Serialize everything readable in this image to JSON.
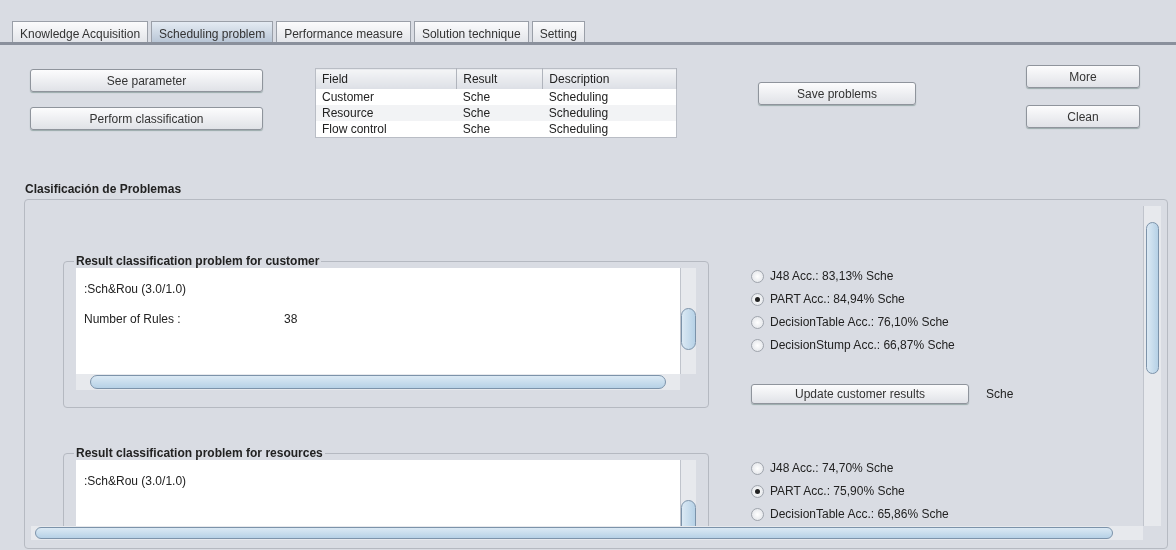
{
  "tabs": [
    {
      "label": "Knowledge Acquisition",
      "selected": false
    },
    {
      "label": "Scheduling problem",
      "selected": true
    },
    {
      "label": "Performance measure",
      "selected": false
    },
    {
      "label": "Solution technique",
      "selected": false
    },
    {
      "label": "Setting",
      "selected": false
    }
  ],
  "left_buttons": [
    "See parameter",
    "Perform classification"
  ],
  "table": {
    "columns": [
      "Field",
      "Result",
      "Description"
    ],
    "rows": [
      [
        "Customer",
        "Sche",
        "Scheduling"
      ],
      [
        "Resource",
        "Sche",
        "Scheduling"
      ],
      [
        "Flow control",
        "Sche",
        "Scheduling"
      ]
    ]
  },
  "save_button": "Save problems",
  "right_buttons": [
    "More",
    "Clean"
  ],
  "section_title": "Clasificación de Problemas",
  "panels": [
    {
      "title": "Result classification problem for customer",
      "lines": [
        {
          "label": ":Sch&Rou (3.0/1.0)"
        },
        {
          "label": "Number of Rules  :",
          "value": "38"
        }
      ],
      "options": [
        {
          "label": "J48 Acc.: 83,13% Sche",
          "selected": false
        },
        {
          "label": "PART Acc.: 84,94% Sche",
          "selected": true
        },
        {
          "label": "DecisionTable Acc.: 76,10% Sche",
          "selected": false
        },
        {
          "label": "DecisionStump Acc.: 66,87% Sche",
          "selected": false
        }
      ],
      "update_button": "Update customer results",
      "result": "Sche"
    },
    {
      "title": "Result classification problem for resources",
      "lines": [
        {
          "label": ":Sch&Rou (3.0/1.0)"
        }
      ],
      "options": [
        {
          "label": "J48 Acc.: 74,70% Sche",
          "selected": false
        },
        {
          "label": "PART Acc.: 75,90% Sche",
          "selected": true
        },
        {
          "label": "DecisionTable Acc.: 65,86% Sche",
          "selected": false
        }
      ]
    }
  ]
}
